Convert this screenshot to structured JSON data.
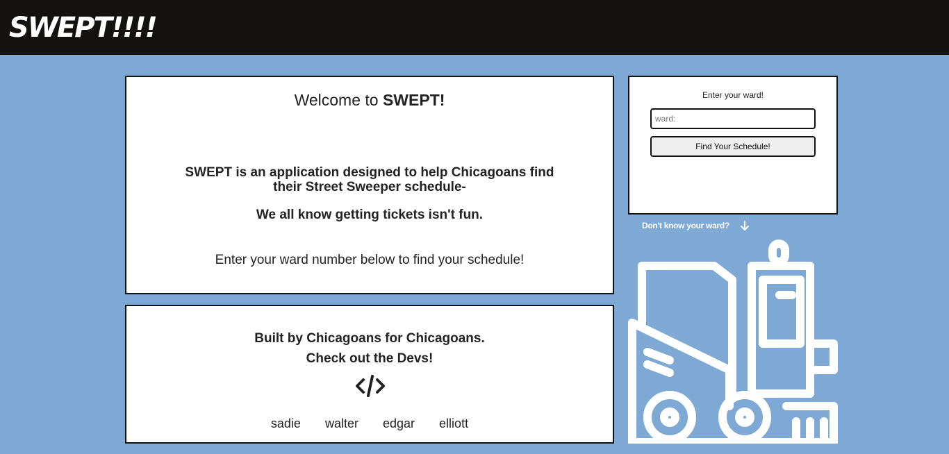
{
  "header": {
    "logo": "SWEPT!!!!"
  },
  "welcome": {
    "title_prefix": "Welcome to ",
    "title_brand": "SWEPT!",
    "description": "SWEPT is an application designed to help Chicagoans find their Street Sweeper schedule-",
    "tickets": "We all know getting tickets isn't fun.",
    "instruction": "Enter your ward number below to find your schedule!"
  },
  "devs_card": {
    "built": "Built by Chicagoans for Chicagoans.",
    "check": "Check out the Devs!",
    "code_icon": "code-icon",
    "devs": [
      "sadie",
      "walter",
      "edgar",
      "elliott"
    ]
  },
  "ward_form": {
    "label": "Enter your ward!",
    "placeholder": "ward:",
    "value": "",
    "button": "Find Your Schedule!"
  },
  "help": {
    "dont_know": "Don't know your ward?",
    "arrow_icon": "arrow-down-icon"
  },
  "illustration": {
    "icon": "street-sweeper-icon"
  },
  "colors": {
    "background": "#7ea9d5",
    "header": "#141211",
    "card": "#ffffff",
    "border": "#111111"
  }
}
